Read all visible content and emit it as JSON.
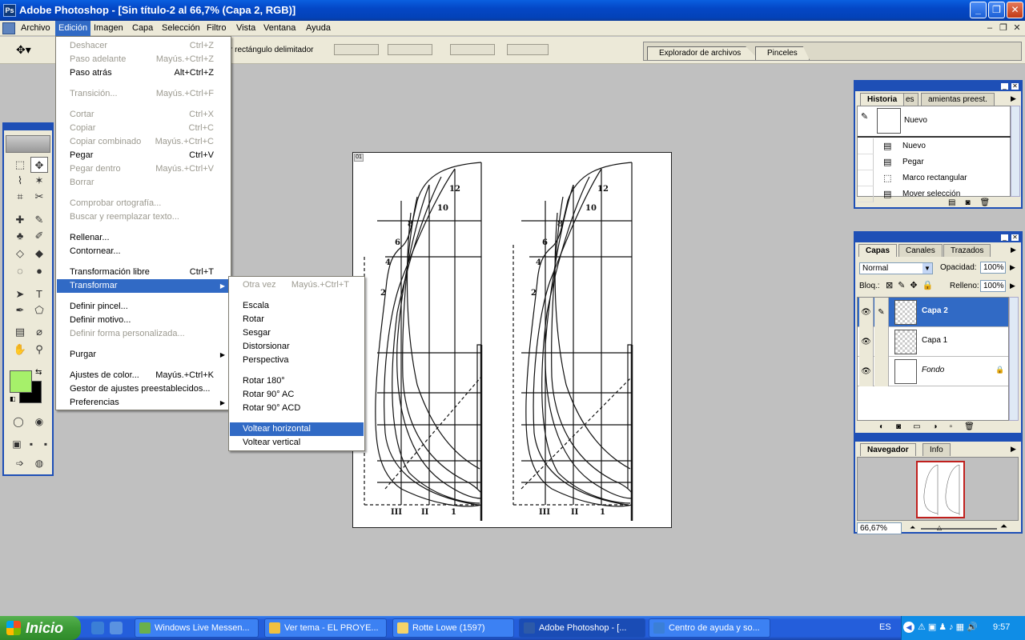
{
  "window": {
    "title": "Adobe Photoshop - [Sin título-2 al 66,7% (Capa 2, RGB)]",
    "app_icon_glyph": "Ps"
  },
  "menubar": {
    "items": [
      "Archivo",
      "Edición",
      "Imagen",
      "Capa",
      "Selección",
      "Filtro",
      "Vista",
      "Ventana",
      "Ayuda"
    ],
    "active": "Edición"
  },
  "options_bar": {
    "text": "r rectángulo delimitador",
    "well_tabs": [
      "Explorador de archivos",
      "Pinceles"
    ]
  },
  "edit_menu": {
    "items": [
      {
        "label": "Deshacer",
        "shortcut": "Ctrl+Z",
        "disabled": true
      },
      {
        "label": "Paso adelante",
        "shortcut": "Mayús.+Ctrl+Z",
        "disabled": true
      },
      {
        "label": "Paso atrás",
        "shortcut": "Alt+Ctrl+Z",
        "disabled": false
      },
      {
        "label": "Transición...",
        "shortcut": "Mayús.+Ctrl+F",
        "disabled": true
      },
      {
        "label": "Cortar",
        "shortcut": "Ctrl+X",
        "disabled": true
      },
      {
        "label": "Copiar",
        "shortcut": "Ctrl+C",
        "disabled": true
      },
      {
        "label": "Copiar combinado",
        "shortcut": "Mayús.+Ctrl+C",
        "disabled": true
      },
      {
        "label": "Pegar",
        "shortcut": "Ctrl+V",
        "disabled": false
      },
      {
        "label": "Pegar dentro",
        "shortcut": "Mayús.+Ctrl+V",
        "disabled": true
      },
      {
        "label": "Borrar",
        "shortcut": "",
        "disabled": true
      },
      {
        "label": "Comprobar ortografía...",
        "shortcut": "",
        "disabled": true
      },
      {
        "label": "Buscar y reemplazar texto...",
        "shortcut": "",
        "disabled": true
      },
      {
        "label": "Rellenar...",
        "shortcut": "",
        "disabled": false
      },
      {
        "label": "Contornear...",
        "shortcut": "",
        "disabled": false
      },
      {
        "label": "Transformación libre",
        "shortcut": "Ctrl+T",
        "disabled": false
      },
      {
        "label": "Transformar",
        "shortcut": "",
        "disabled": false,
        "submenu": true,
        "highlighted": true
      },
      {
        "label": "Definir pincel...",
        "shortcut": "",
        "disabled": false
      },
      {
        "label": "Definir motivo...",
        "shortcut": "",
        "disabled": false
      },
      {
        "label": "Definir forma personalizada...",
        "shortcut": "",
        "disabled": true
      },
      {
        "label": "Purgar",
        "shortcut": "",
        "disabled": false,
        "submenu": true
      },
      {
        "label": "Ajustes de color...",
        "shortcut": "Mayús.+Ctrl+K",
        "disabled": false
      },
      {
        "label": "Gestor de ajustes preestablecidos...",
        "shortcut": "",
        "disabled": false
      },
      {
        "label": "Preferencias",
        "shortcut": "",
        "disabled": false,
        "submenu": true
      }
    ]
  },
  "transform_menu": {
    "items": [
      {
        "label": "Otra vez",
        "shortcut": "Mayús.+Ctrl+T",
        "disabled": true
      },
      {
        "label": "Escala",
        "shortcut": "",
        "disabled": false
      },
      {
        "label": "Rotar",
        "shortcut": "",
        "disabled": false
      },
      {
        "label": "Sesgar",
        "shortcut": "",
        "disabled": false
      },
      {
        "label": "Distorsionar",
        "shortcut": "",
        "disabled": false
      },
      {
        "label": "Perspectiva",
        "shortcut": "",
        "disabled": false
      },
      {
        "label": "Rotar 180°",
        "shortcut": "",
        "disabled": false
      },
      {
        "label": "Rotar 90° AC",
        "shortcut": "",
        "disabled": false
      },
      {
        "label": "Rotar 90° ACD",
        "shortcut": "",
        "disabled": false
      },
      {
        "label": "Voltear horizontal",
        "shortcut": "",
        "disabled": false,
        "highlighted": true
      },
      {
        "label": "Voltear vertical",
        "shortcut": "",
        "disabled": false
      }
    ]
  },
  "canvas": {
    "tag": "01",
    "drawing_labels_left": [
      "12",
      "10",
      "8",
      "6",
      "4",
      "2"
    ],
    "drawing_labels_bottom": [
      "III",
      "II",
      "1"
    ]
  },
  "history_panel": {
    "tabs": [
      "Historia",
      "es",
      "amientas preest."
    ],
    "snapshot": "Nuevo",
    "items": [
      "Nuevo",
      "Pegar",
      "Marco rectangular",
      "Mover selección"
    ]
  },
  "layers_panel": {
    "tabs": [
      "Capas",
      "Canales",
      "Trazados"
    ],
    "blend_mode": "Normal",
    "opacity_label": "Opacidad:",
    "opacity": "100%",
    "lock_label": "Bloq.:",
    "fill_label": "Relleno:",
    "fill": "100%",
    "layers": [
      {
        "name": "Capa 2",
        "selected": true
      },
      {
        "name": "Capa 1",
        "selected": false
      },
      {
        "name": "Fondo",
        "selected": false,
        "locked": true
      }
    ]
  },
  "navigator_panel": {
    "tabs": [
      "Navegador",
      "Info"
    ],
    "zoom": "66,67%"
  },
  "colors": {
    "foreground": "#a6f06a",
    "background": "#000000",
    "accent": "#316ac5"
  },
  "taskbar": {
    "start": "Inicio",
    "tasks": [
      {
        "label": "Windows Live Messen...",
        "active": false,
        "icon_color": "#6ab04c"
      },
      {
        "label": "Ver tema - EL PROYE...",
        "active": false,
        "icon_color": "#f0c040"
      },
      {
        "label": "Rotte Lowe   (1597)",
        "active": false,
        "icon_color": "#f4d36a"
      },
      {
        "label": "Adobe Photoshop - [...",
        "active": true,
        "icon_color": "#2d5aa8"
      },
      {
        "label": "Centro de ayuda y so...",
        "active": false,
        "icon_color": "#3b7fd6"
      }
    ],
    "lang": "ES",
    "clock": "9:57"
  }
}
